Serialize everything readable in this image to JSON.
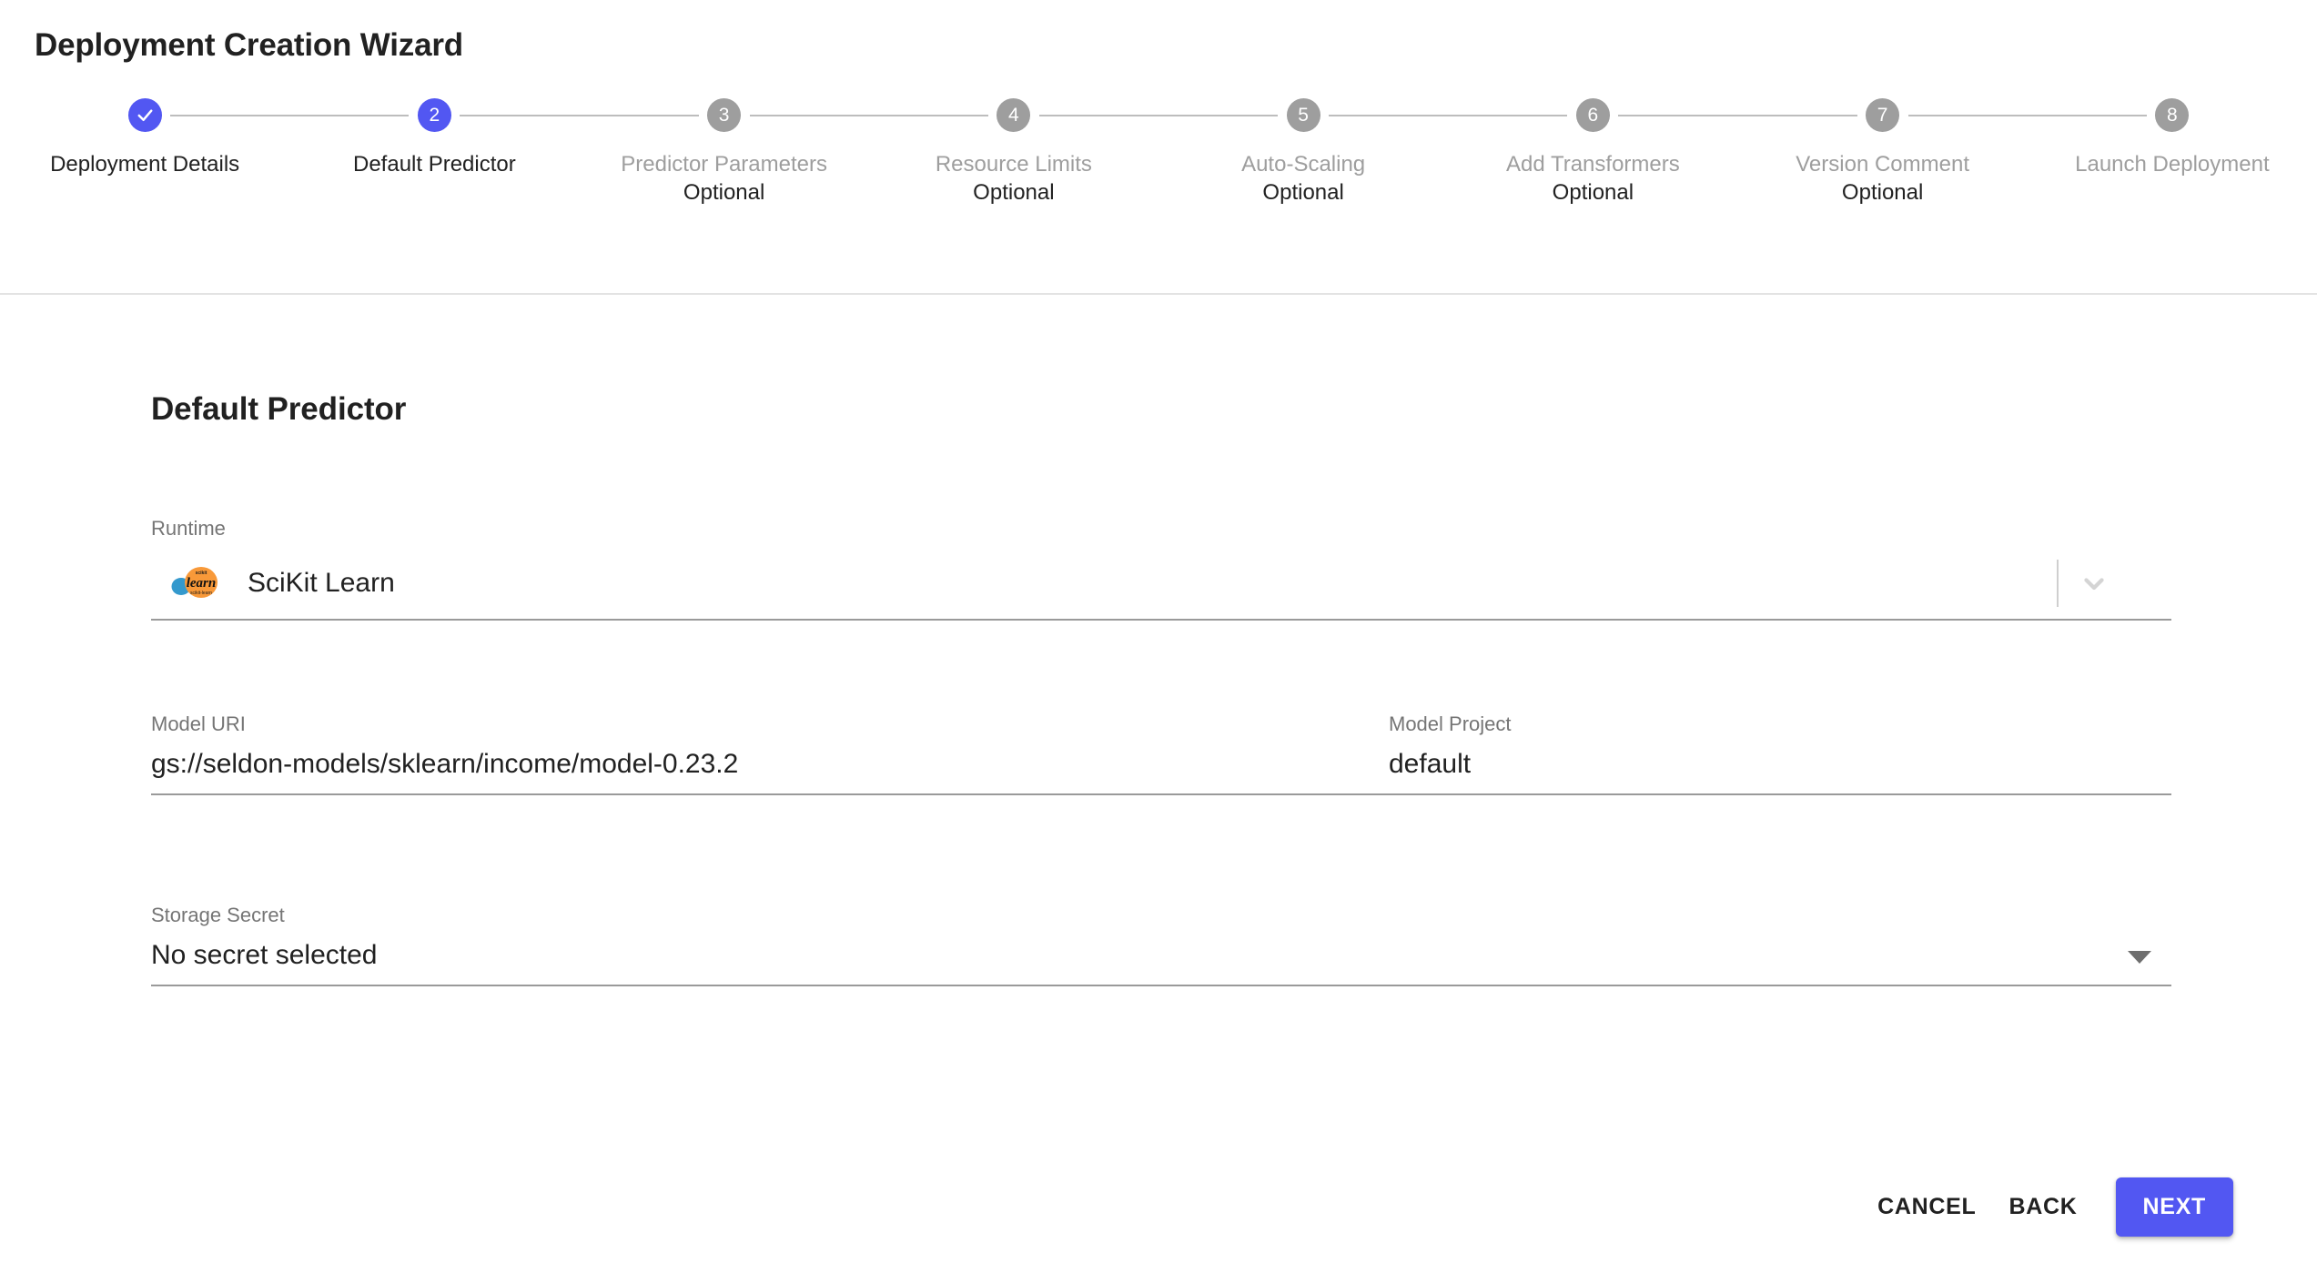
{
  "header": {
    "title": "Deployment Creation Wizard"
  },
  "colors": {
    "accent": "#5257f2",
    "inactive_step": "#9e9e9e",
    "divider": "#e3e3e3",
    "field_underline": "#9a9a9a",
    "label_text": "#757575",
    "value_text": "#212121"
  },
  "stepper": {
    "steps": [
      {
        "number": "1",
        "label": "Deployment Details",
        "optional": "",
        "state": "done"
      },
      {
        "number": "2",
        "label": "Default Predictor",
        "optional": "",
        "state": "active"
      },
      {
        "number": "3",
        "label": "Predictor Parameters",
        "optional": "Optional",
        "state": "pending"
      },
      {
        "number": "4",
        "label": "Resource Limits",
        "optional": "Optional",
        "state": "pending"
      },
      {
        "number": "5",
        "label": "Auto-Scaling",
        "optional": "Optional",
        "state": "pending"
      },
      {
        "number": "6",
        "label": "Add Transformers",
        "optional": "Optional",
        "state": "pending"
      },
      {
        "number": "7",
        "label": "Version Comment",
        "optional": "Optional",
        "state": "pending"
      },
      {
        "number": "8",
        "label": "Launch Deployment",
        "optional": "",
        "state": "pending"
      }
    ]
  },
  "main": {
    "section_heading": "Default Predictor",
    "runtime": {
      "label": "Runtime",
      "value": "SciKit Learn",
      "logo_name": "scikit-learn-logo",
      "dropdown_icon": "chevron-down-icon"
    },
    "model_uri": {
      "label": "Model URI",
      "value": "gs://seldon-models/sklearn/income/model-0.23.2",
      "placeholder": "Model URI"
    },
    "model_project": {
      "label": "Model Project",
      "value": "default",
      "placeholder": "Model Project"
    },
    "storage_secret": {
      "label": "Storage Secret",
      "value": "No secret selected",
      "dropdown_icon": "triangle-down-icon"
    }
  },
  "footer": {
    "cancel_label": "CANCEL",
    "back_label": "BACK",
    "next_label": "NEXT"
  }
}
